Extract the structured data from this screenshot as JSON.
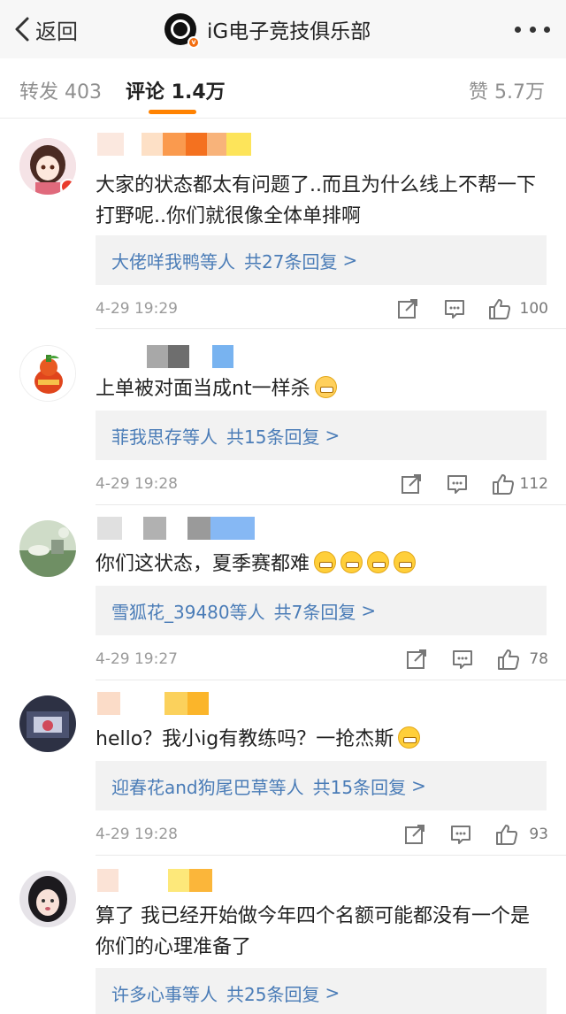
{
  "header": {
    "back_label": "返回",
    "title": "iG电子竞技俱乐部",
    "icons": [
      "chevron-left-icon",
      "club-logo",
      "verified-badge-icon",
      "more-dots-icon"
    ]
  },
  "tabs": [
    {
      "label": "转发 403",
      "active": false
    },
    {
      "label": "评论 1.4万",
      "active": true
    },
    {
      "label": "赞 5.7万",
      "active": false
    }
  ],
  "accent_color": "#ff8200",
  "link_color": "#4a7cb7",
  "comments": [
    {
      "text": "大家的状态都太有问题了..而且为什么线上不帮一下打野呢..你们就很像全体单排啊",
      "reply_names": "大佬咩我鸭",
      "reply_suffix": "等人",
      "reply_count": "共27条回复",
      "reply_arrow": ">",
      "time": "4-29 19:29",
      "likes": "100"
    },
    {
      "text": "上单被对面当成nt一样杀",
      "reply_names": "菲我思存",
      "reply_suffix": "等人",
      "reply_count": "共15条回复",
      "reply_arrow": ">",
      "time": "4-29 19:28",
      "likes": "112"
    },
    {
      "text": "你们这状态，夏季赛都难",
      "reply_names": "雪狐花_39480",
      "reply_suffix": "等人",
      "reply_count": "共7条回复",
      "reply_arrow": ">",
      "time": "4-29 19:27",
      "likes": "78"
    },
    {
      "text": "hello？我小ig有教练吗？一抢杰斯",
      "reply_names": "迎春花and狗尾巴草",
      "reply_suffix": "等人",
      "reply_count": "共15条回复",
      "reply_arrow": ">",
      "time": "4-29 19:28",
      "likes": "93"
    },
    {
      "text": "算了 我已经开始做今年四个名额可能都没有一个是你们的心理准备了",
      "reply_names": "许多心事",
      "reply_suffix": "等人",
      "reply_count": "共25条回复",
      "reply_arrow": ">"
    }
  ]
}
